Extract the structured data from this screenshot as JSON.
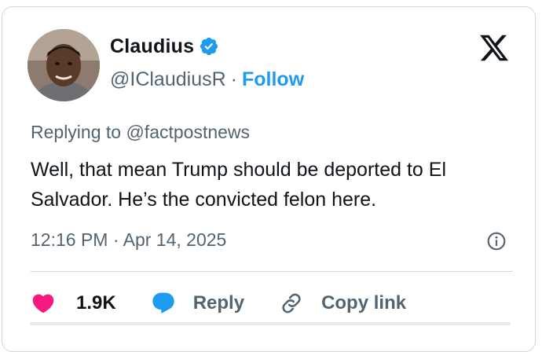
{
  "author": {
    "name": "Claudius",
    "handle": "@IClaudiusR",
    "separator": "·",
    "follow_label": "Follow"
  },
  "reply_context": "Replying to @factpostnews",
  "tweet": {
    "text": "Well, that mean Trump should be deported to El Salvador. He’s the convicted felon here."
  },
  "meta": {
    "timestamp": "12:16 PM · Apr 14, 2025"
  },
  "actions": {
    "likes": "1.9K",
    "reply_label": "Reply",
    "copy_link_label": "Copy link"
  },
  "colors": {
    "accent": "#1d9bf0",
    "like": "#f91880",
    "secondary_text": "#536471",
    "border": "#cfd9de"
  },
  "icons": [
    "x-logo-icon",
    "verified-badge-icon",
    "info-icon",
    "heart-icon",
    "reply-bubble-icon",
    "link-icon"
  ]
}
